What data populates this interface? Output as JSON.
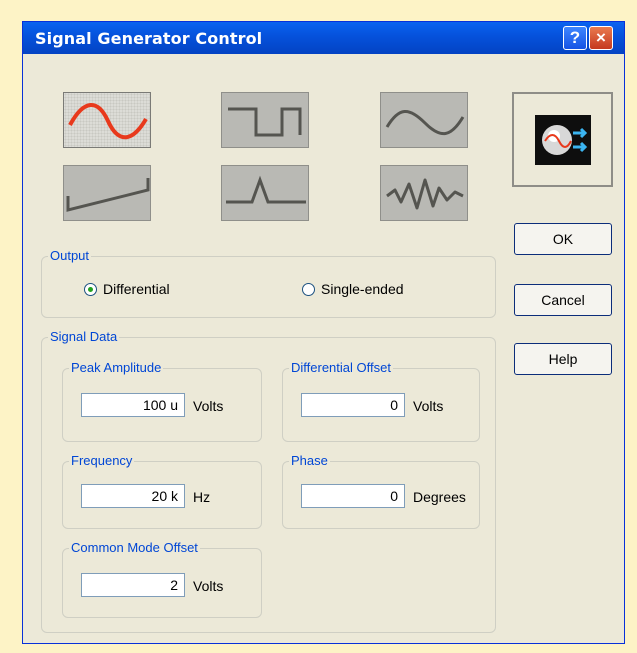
{
  "window": {
    "title": "Signal Generator Control",
    "help_label": "?",
    "close_label": "×"
  },
  "waveforms": [
    {
      "name": "sine",
      "selected": true,
      "icon": "sine-wave-icon"
    },
    {
      "name": "square",
      "selected": false,
      "icon": "square-wave-icon"
    },
    {
      "name": "triangle",
      "selected": false,
      "icon": "triangle-wave-icon"
    },
    {
      "name": "sawtooth",
      "selected": false,
      "icon": "sawtooth-wave-icon"
    },
    {
      "name": "pulse",
      "selected": false,
      "icon": "pulse-wave-icon"
    },
    {
      "name": "arbitrary",
      "selected": false,
      "icon": "arbitrary-wave-icon"
    }
  ],
  "preview_icon": "signal-generator-icon",
  "buttons": {
    "ok": "OK",
    "cancel": "Cancel",
    "help": "Help"
  },
  "output": {
    "label": "Output",
    "options": [
      {
        "label": "Differential",
        "selected": true
      },
      {
        "label": "Single-ended",
        "selected": false
      }
    ]
  },
  "signal_data": {
    "label": "Signal Data",
    "peak_amplitude": {
      "label": "Peak Amplitude",
      "value": "100 u",
      "unit": "Volts"
    },
    "differential_offset": {
      "label": "Differential Offset",
      "value": "0",
      "unit": "Volts"
    },
    "frequency": {
      "label": "Frequency",
      "value": "20 k",
      "unit": "Hz"
    },
    "phase": {
      "label": "Phase",
      "value": "0",
      "unit": "Degrees"
    },
    "common_mode_offset": {
      "label": "Common Mode Offset",
      "value": "2",
      "unit": "Volts"
    }
  },
  "colors": {
    "titlebar": "#0551db",
    "group_label": "#0046d5",
    "selected_wave": "#e8391c",
    "wave_line": "#555550",
    "dialog_bg": "#ece9d8",
    "page_bg": "#fdf3c6"
  }
}
